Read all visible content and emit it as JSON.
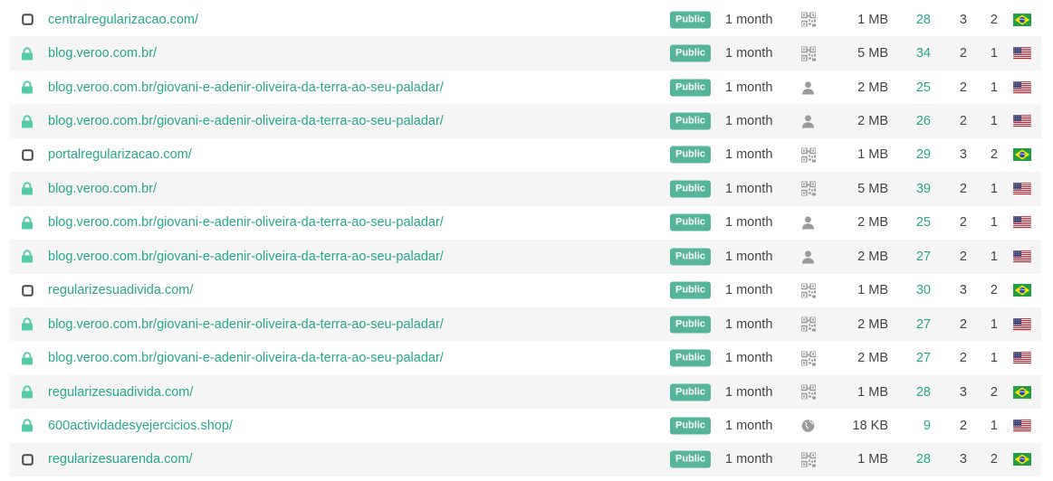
{
  "colors": {
    "link": "#26a789",
    "badge": "#56b49a",
    "icon_green": "#56c9a6",
    "icon_gray": "#9a9a9a"
  },
  "rows": [
    {
      "status_icon": "unlocked-icon",
      "url": "centralregularizacao.com/",
      "visibility": "Public",
      "expiry": "1 month",
      "type_icon": "qr-code-icon",
      "size": "1 MB",
      "hits": "28",
      "col_a": "3",
      "col_b": "2",
      "flag": "brazil-flag"
    },
    {
      "status_icon": "lock-icon",
      "url": "blog.veroo.com.br/",
      "visibility": "Public",
      "expiry": "1 month",
      "type_icon": "qr-code-icon",
      "size": "5 MB",
      "hits": "34",
      "col_a": "2",
      "col_b": "1",
      "flag": "usa-flag"
    },
    {
      "status_icon": "lock-icon",
      "url": "blog.veroo.com.br/giovani-e-adenir-oliveira-da-terra-ao-seu-paladar/",
      "visibility": "Public",
      "expiry": "1 month",
      "type_icon": "user-icon",
      "size": "2 MB",
      "hits": "25",
      "col_a": "2",
      "col_b": "1",
      "flag": "usa-flag"
    },
    {
      "status_icon": "lock-icon",
      "url": "blog.veroo.com.br/giovani-e-adenir-oliveira-da-terra-ao-seu-paladar/",
      "visibility": "Public",
      "expiry": "1 month",
      "type_icon": "user-icon",
      "size": "2 MB",
      "hits": "26",
      "col_a": "2",
      "col_b": "1",
      "flag": "usa-flag"
    },
    {
      "status_icon": "unlocked-icon",
      "url": "portalregularizacao.com/",
      "visibility": "Public",
      "expiry": "1 month",
      "type_icon": "qr-code-icon",
      "size": "1 MB",
      "hits": "29",
      "col_a": "3",
      "col_b": "2",
      "flag": "brazil-flag"
    },
    {
      "status_icon": "lock-icon",
      "url": "blog.veroo.com.br/",
      "visibility": "Public",
      "expiry": "1 month",
      "type_icon": "qr-code-icon",
      "size": "5 MB",
      "hits": "39",
      "col_a": "2",
      "col_b": "1",
      "flag": "usa-flag"
    },
    {
      "status_icon": "lock-icon",
      "url": "blog.veroo.com.br/giovani-e-adenir-oliveira-da-terra-ao-seu-paladar/",
      "visibility": "Public",
      "expiry": "1 month",
      "type_icon": "user-icon",
      "size": "2 MB",
      "hits": "25",
      "col_a": "2",
      "col_b": "1",
      "flag": "usa-flag"
    },
    {
      "status_icon": "lock-icon",
      "url": "blog.veroo.com.br/giovani-e-adenir-oliveira-da-terra-ao-seu-paladar/",
      "visibility": "Public",
      "expiry": "1 month",
      "type_icon": "user-icon",
      "size": "2 MB",
      "hits": "27",
      "col_a": "2",
      "col_b": "1",
      "flag": "usa-flag"
    },
    {
      "status_icon": "unlocked-icon",
      "url": "regularizesuadivida.com/",
      "visibility": "Public",
      "expiry": "1 month",
      "type_icon": "qr-code-icon",
      "size": "1 MB",
      "hits": "30",
      "col_a": "3",
      "col_b": "2",
      "flag": "brazil-flag"
    },
    {
      "status_icon": "lock-icon",
      "url": "blog.veroo.com.br/giovani-e-adenir-oliveira-da-terra-ao-seu-paladar/",
      "visibility": "Public",
      "expiry": "1 month",
      "type_icon": "qr-code-icon",
      "size": "2 MB",
      "hits": "27",
      "col_a": "2",
      "col_b": "1",
      "flag": "usa-flag"
    },
    {
      "status_icon": "lock-icon",
      "url": "blog.veroo.com.br/giovani-e-adenir-oliveira-da-terra-ao-seu-paladar/",
      "visibility": "Public",
      "expiry": "1 month",
      "type_icon": "qr-code-icon",
      "size": "2 MB",
      "hits": "27",
      "col_a": "2",
      "col_b": "1",
      "flag": "usa-flag"
    },
    {
      "status_icon": "lock-icon",
      "url": "regularizesuadivida.com/",
      "visibility": "Public",
      "expiry": "1 month",
      "type_icon": "qr-code-icon",
      "size": "1 MB",
      "hits": "28",
      "col_a": "3",
      "col_b": "2",
      "flag": "brazil-flag"
    },
    {
      "status_icon": "lock-icon",
      "url": "600actividadesyejercicios.shop/",
      "visibility": "Public",
      "expiry": "1 month",
      "type_icon": "globe-icon",
      "size": "18 KB",
      "hits": "9",
      "col_a": "2",
      "col_b": "1",
      "flag": "usa-flag"
    },
    {
      "status_icon": "unlocked-icon",
      "url": "regularizesuarenda.com/",
      "visibility": "Public",
      "expiry": "1 month",
      "type_icon": "qr-code-icon",
      "size": "1 MB",
      "hits": "28",
      "col_a": "3",
      "col_b": "2",
      "flag": "brazil-flag"
    }
  ]
}
